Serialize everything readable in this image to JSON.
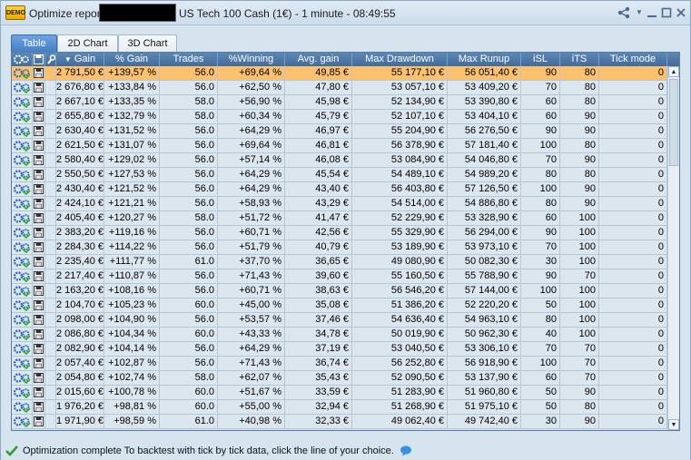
{
  "titlebar": {
    "demo_badge": "DEMO",
    "title_left": "Optimize report",
    "title_right": "US Tech 100 Cash (1€) - 1 minute - 08:49:55"
  },
  "tabs": [
    {
      "label": "Table",
      "active": true
    },
    {
      "label": "2D Chart",
      "active": false
    },
    {
      "label": "3D Chart",
      "active": false
    }
  ],
  "table": {
    "columns": [
      "Gain",
      "% Gain",
      "Trades",
      "%Winning",
      "Avg. gain",
      "Max Drawdown",
      "Max Runup",
      "iSL",
      "iTS",
      "Tick mode"
    ],
    "sort_indicator": "▼",
    "rows": [
      [
        "2 791,50 €",
        "+139,57 %",
        "56.0",
        "+69,64 %",
        "49,85 €",
        "55 177,10 €",
        "56 051,40 €",
        "90",
        "80",
        "0"
      ],
      [
        "2 676,80 €",
        "+133,84 %",
        "56.0",
        "+62,50 %",
        "47,80 €",
        "53 057,10 €",
        "53 409,20 €",
        "70",
        "80",
        "0"
      ],
      [
        "2 667,10 €",
        "+133,35 %",
        "58.0",
        "+56,90 %",
        "45,98 €",
        "52 134,90 €",
        "53 390,80 €",
        "60",
        "80",
        "0"
      ],
      [
        "2 655,80 €",
        "+132,79 %",
        "58.0",
        "+60,34 %",
        "45,79 €",
        "52 107,10 €",
        "53 404,10 €",
        "60",
        "90",
        "0"
      ],
      [
        "2 630,40 €",
        "+131,52 %",
        "56.0",
        "+64,29 %",
        "46,97 €",
        "55 204,90 €",
        "56 276,50 €",
        "90",
        "90",
        "0"
      ],
      [
        "2 621,50 €",
        "+131,07 %",
        "56.0",
        "+69,64 %",
        "46,81 €",
        "56 378,90 €",
        "57 181,40 €",
        "100",
        "80",
        "0"
      ],
      [
        "2 580,40 €",
        "+129,02 %",
        "56.0",
        "+57,14 %",
        "46,08 €",
        "53 084,90 €",
        "54 046,80 €",
        "70",
        "90",
        "0"
      ],
      [
        "2 550,50 €",
        "+127,53 %",
        "56.0",
        "+64,29 %",
        "45,54 €",
        "54 489,10 €",
        "54 989,20 €",
        "80",
        "80",
        "0"
      ],
      [
        "2 430,40 €",
        "+121,52 %",
        "56.0",
        "+64,29 %",
        "43,40 €",
        "56 403,80 €",
        "57 126,50 €",
        "100",
        "90",
        "0"
      ],
      [
        "2 424,10 €",
        "+121,21 %",
        "56.0",
        "+58,93 %",
        "43,29 €",
        "54 514,00 €",
        "54 886,80 €",
        "80",
        "90",
        "0"
      ],
      [
        "2 405,40 €",
        "+120,27 %",
        "58.0",
        "+51,72 %",
        "41,47 €",
        "52 229,90 €",
        "53 328,90 €",
        "60",
        "100",
        "0"
      ],
      [
        "2 383,20 €",
        "+119,16 %",
        "56.0",
        "+60,71 %",
        "42,56 €",
        "55 329,90 €",
        "56 294,00 €",
        "90",
        "100",
        "0"
      ],
      [
        "2 284,30 €",
        "+114,22 %",
        "56.0",
        "+51,79 %",
        "40,79 €",
        "53 189,90 €",
        "53 973,10 €",
        "70",
        "100",
        "0"
      ],
      [
        "2 235,40 €",
        "+111,77 %",
        "61.0",
        "+37,70 %",
        "36,65 €",
        "49 080,90 €",
        "50 082,30 €",
        "30",
        "100",
        "0"
      ],
      [
        "2 217,40 €",
        "+110,87 %",
        "56.0",
        "+71,43 %",
        "39,60 €",
        "55 160,50 €",
        "55 788,90 €",
        "90",
        "70",
        "0"
      ],
      [
        "2 163,20 €",
        "+108,16 %",
        "56.0",
        "+60,71 %",
        "38,63 €",
        "56 546,20 €",
        "57 144,00 €",
        "100",
        "100",
        "0"
      ],
      [
        "2 104,70 €",
        "+105,23 %",
        "60.0",
        "+45,00 %",
        "35,08 €",
        "51 386,20 €",
        "52 220,20 €",
        "50",
        "100",
        "0"
      ],
      [
        "2 098,00 €",
        "+104,90 %",
        "56.0",
        "+53,57 %",
        "37,46 €",
        "54 636,40 €",
        "54 963,10 €",
        "80",
        "100",
        "0"
      ],
      [
        "2 086,80 €",
        "+104,34 %",
        "60.0",
        "+43,33 %",
        "34,78 €",
        "50 019,90 €",
        "50 962,30 €",
        "40",
        "100",
        "0"
      ],
      [
        "2 082,90 €",
        "+104,14 %",
        "56.0",
        "+64,29 %",
        "37,19 €",
        "53 040,50 €",
        "53 306,10 €",
        "70",
        "70",
        "0"
      ],
      [
        "2 057,40 €",
        "+102,87 %",
        "56.0",
        "+71,43 %",
        "36,74 €",
        "56 252,80 €",
        "56 918,90 €",
        "100",
        "70",
        "0"
      ],
      [
        "2 054,80 €",
        "+102,74 %",
        "58.0",
        "+62,07 %",
        "35,43 €",
        "52 090,50 €",
        "53 137,90 €",
        "60",
        "70",
        "0"
      ],
      [
        "2 015,60 €",
        "+100,78 %",
        "60.0",
        "+51,67 %",
        "33,59 €",
        "51 283,90 €",
        "51 960,80 €",
        "50",
        "90",
        "0"
      ],
      [
        "1 976,20 €",
        "+98,81 %",
        "60.0",
        "+55,00 %",
        "32,94 €",
        "51 268,90 €",
        "51 975,10 €",
        "50",
        "80",
        "0"
      ],
      [
        "1 971,90 €",
        "+98,59 %",
        "61.0",
        "+40,98 %",
        "32,33 €",
        "49 062,40 €",
        "49 742,40 €",
        "30",
        "90",
        "0"
      ]
    ]
  },
  "status": {
    "text": "Optimization complete   To backtest with tick by tick data, click the line of your choice."
  },
  "colors": {
    "header_bg": "#4a76a6",
    "selected_row": "#fbc16e",
    "row_bg": "#dbe6ef",
    "active_tab": "#4f8ccc",
    "demo_badge": "#f5b800"
  }
}
